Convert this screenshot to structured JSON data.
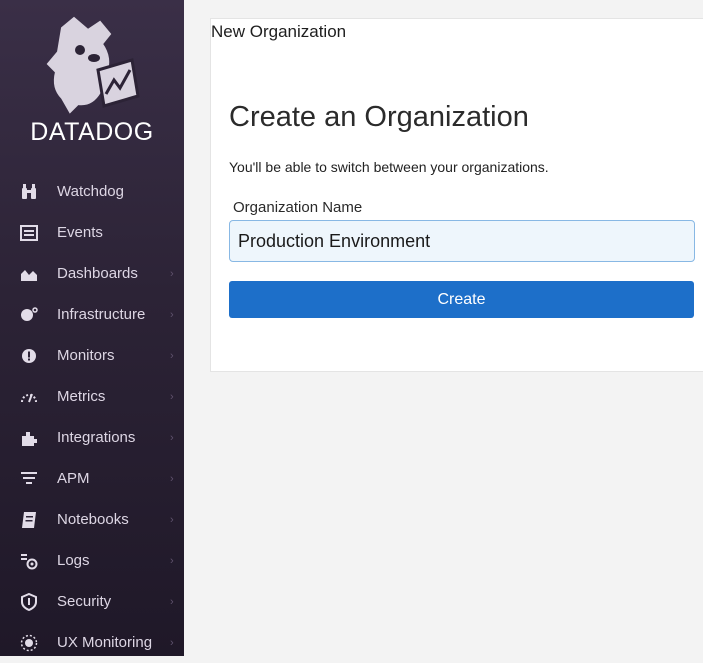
{
  "brand": {
    "name": "DATADOG"
  },
  "sidebar": {
    "items": [
      {
        "label": "Watchdog",
        "icon": "binoculars-icon",
        "has_submenu": false
      },
      {
        "label": "Events",
        "icon": "events-list-icon",
        "has_submenu": false
      },
      {
        "label": "Dashboards",
        "icon": "dashboard-chart-icon",
        "has_submenu": true
      },
      {
        "label": "Infrastructure",
        "icon": "infrastructure-icon",
        "has_submenu": true
      },
      {
        "label": "Monitors",
        "icon": "alert-circle-icon",
        "has_submenu": true
      },
      {
        "label": "Metrics",
        "icon": "gauge-icon",
        "has_submenu": true
      },
      {
        "label": "Integrations",
        "icon": "puzzle-piece-icon",
        "has_submenu": true
      },
      {
        "label": "APM",
        "icon": "apm-icon",
        "has_submenu": true
      },
      {
        "label": "Notebooks",
        "icon": "notebook-icon",
        "has_submenu": true
      },
      {
        "label": "Logs",
        "icon": "logs-icon",
        "has_submenu": true
      },
      {
        "label": "Security",
        "icon": "shield-icon",
        "has_submenu": true
      },
      {
        "label": "UX Monitoring",
        "icon": "ux-monitoring-icon",
        "has_submenu": true
      }
    ],
    "chevron": "›"
  },
  "main": {
    "breadcrumb": "New Organization",
    "title": "Create an Organization",
    "subtitle": "You'll be able to switch between your organizations.",
    "form": {
      "org_name_label": "Organization Name",
      "org_name_value": "Production Environment",
      "create_label": "Create"
    }
  },
  "colors": {
    "sidebar_bg": "#2c2336",
    "accent": "#1d6fc9",
    "input_bg": "#eef6fc",
    "input_border": "#88b8e4"
  }
}
